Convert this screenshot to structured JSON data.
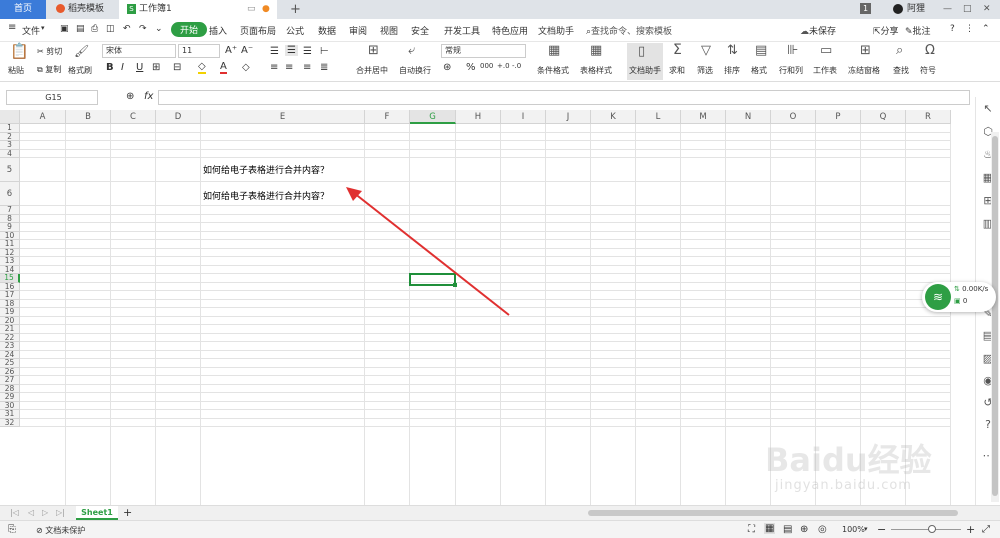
{
  "tabs": {
    "home": "首页",
    "template": "稻壳模板",
    "workbook": "工作簿1",
    "badge": "1",
    "user": "阿狸"
  },
  "menu": {
    "file": "文件",
    "start": "开始",
    "insert": "插入",
    "layout": "页面布局",
    "formula": "公式",
    "data": "数据",
    "review": "审阅",
    "view": "视图",
    "security": "安全",
    "devtools": "开发工具",
    "special": "特色应用",
    "doc_helper": "文档助手",
    "search": "查找命令、搜索模板",
    "unsaved": "未保存",
    "share": "分享",
    "comment": "批注"
  },
  "ribbon": {
    "paste": "粘贴",
    "cut": "剪切",
    "copy": "复制",
    "format_painter": "格式刷",
    "font": "宋体",
    "font_size": "11",
    "merge_center": "合并居中",
    "wrap_text": "自动换行",
    "number_format": "常规",
    "conditional_format": "条件格式",
    "table_style": "表格样式",
    "doc_helper": "文档助手",
    "sum": "求和",
    "filter": "筛选",
    "sort": "排序",
    "format": "格式",
    "row_col": "行和列",
    "worksheet": "工作表",
    "freeze": "冻结窗格",
    "find": "查找",
    "symbol": "符号"
  },
  "formula_bar": {
    "cell_ref": "G15",
    "fx": "fx",
    "content": ""
  },
  "columns": [
    "A",
    "B",
    "C",
    "D",
    "E",
    "F",
    "G",
    "H",
    "I",
    "J",
    "K",
    "L",
    "M",
    "N",
    "O",
    "P",
    "Q",
    "R"
  ],
  "rows": [
    "1",
    "2",
    "3",
    "4",
    "5",
    "6",
    "7",
    "8",
    "9",
    "10",
    "11",
    "12",
    "13",
    "14",
    "15",
    "16",
    "17",
    "18",
    "19",
    "20",
    "21",
    "22",
    "23",
    "24",
    "25",
    "26",
    "27",
    "28",
    "29",
    "30",
    "31",
    "32"
  ],
  "cells": {
    "e5": "如何给电子表格进行合并内容？",
    "e6": "如何给电子表格进行合并内容？"
  },
  "network_widget": {
    "speed": "0.00K/s",
    "count": "0"
  },
  "sheet_tab": "Sheet1",
  "status": {
    "protect": "文档未保护",
    "zoom": "100%"
  },
  "watermark": {
    "logo": "Baidu经验",
    "url": "jingyan.baidu.com"
  },
  "colors": {
    "accent_green": "#2e9e44",
    "arrow_red": "#e03030",
    "selection_green": "#1f8f3a"
  }
}
